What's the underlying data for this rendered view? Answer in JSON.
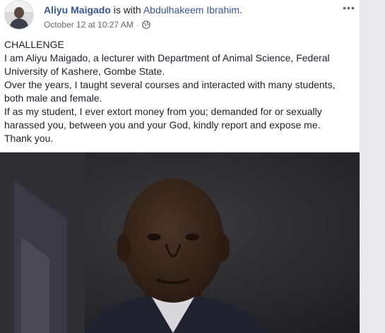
{
  "post": {
    "author": "Aliyu Maigado",
    "with_text": "is with",
    "tagged": "Abdulhakeem Ibrahim.",
    "timestamp": "October 12 at 10:27 AM",
    "separator": "·",
    "audience_icon": "globe-icon",
    "more_icon": "more-options-icon",
    "more_label": "•••",
    "lines": [
      "CHALLENGE",
      "I am Aliyu Maigado, a lecturer with Department of Animal Science, Federal University of Kashere, Gombe State.",
      "Over the years, I taught several courses and interacted with many students, both male and female.",
      "If as my student, I ever extort money from you; demanded for or sexually harassed you, between you and your God, kindly report and expose me.",
      "Thank you."
    ]
  },
  "colors": {
    "link": "#365899",
    "text": "#1d2129",
    "meta": "#616770"
  }
}
